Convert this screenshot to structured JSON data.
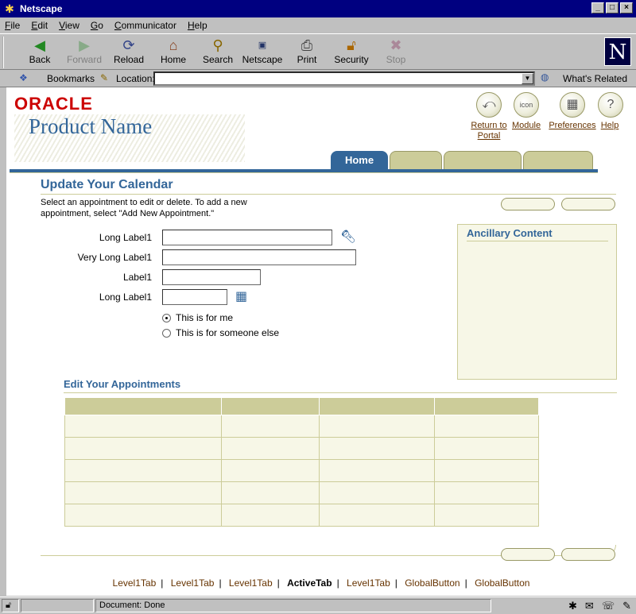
{
  "window": {
    "title": "Netscape"
  },
  "menu": [
    "File",
    "Edit",
    "View",
    "Go",
    "Communicator",
    "Help"
  ],
  "toolbar": {
    "back": "Back",
    "forward": "Forward",
    "reload": "Reload",
    "home": "Home",
    "search": "Search",
    "netscape": "Netscape",
    "print": "Print",
    "security": "Security",
    "stop": "Stop"
  },
  "locationbar": {
    "bookmarks": "Bookmarks",
    "location": "Location:",
    "related": "What's Related",
    "url": ""
  },
  "header": {
    "brand": "ORACLE",
    "product": "Product Name",
    "globals": {
      "return": "Return to Portal",
      "module": "Module",
      "preferences": "Preferences",
      "help": "Help",
      "module_icon_text": "icon"
    }
  },
  "tabs": {
    "active": "Home"
  },
  "page": {
    "title": "Update Your Calendar",
    "instructions": "Select an appointment to edit or delete. To add a new appointment, select \"Add New Appointment.\""
  },
  "form": {
    "label1": "Long Label1",
    "label2": "Very Long Label1",
    "label3": "Label1",
    "label4": "Long Label1",
    "radio1": "This is for me",
    "radio2": "This is for someone else"
  },
  "ancillary": {
    "title": "Ancillary Content"
  },
  "appointments": {
    "title": "Edit Your Appointments"
  },
  "footer": {
    "links": [
      "Level1Tab",
      "Level1Tab",
      "Level1Tab",
      "ActiveTab",
      "Level1Tab",
      "GlobalButton",
      "GlobalButton"
    ]
  },
  "status": {
    "text": "Document: Done"
  }
}
